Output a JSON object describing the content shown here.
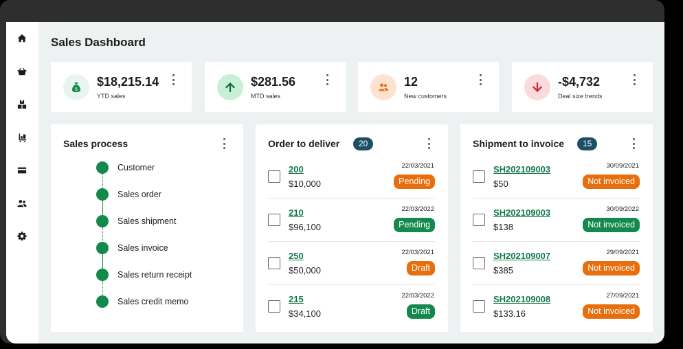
{
  "page_title": "Sales Dashboard",
  "colors": {
    "green_badge": "#138a4b",
    "orange_badge": "#e86d0c",
    "dark_badge": "#1d4e63",
    "link": "#14794a"
  },
  "sidebar": {
    "items": [
      {
        "icon": "home-icon"
      },
      {
        "icon": "basket-icon"
      },
      {
        "icon": "boxes-icon"
      },
      {
        "icon": "forklift-icon"
      },
      {
        "icon": "card-icon"
      },
      {
        "icon": "people-icon"
      },
      {
        "icon": "gear-icon"
      }
    ]
  },
  "kpis": [
    {
      "value": "$18,215.14",
      "label": "YTD sales",
      "icon": "money-bag-icon",
      "bg": "#e8f4ee",
      "fg": "#138a4b"
    },
    {
      "value": "$281.56",
      "label": "MTD sales",
      "icon": "arrow-up-icon",
      "bg": "#c8f0d6",
      "fg": "#0f6b3a"
    },
    {
      "value": "12",
      "label": "New customers",
      "icon": "people-icon",
      "bg": "#fde2d2",
      "fg": "#e86d0c"
    },
    {
      "value": "-$4,732",
      "label": "Deal size trends",
      "icon": "arrow-down-icon",
      "bg": "#fadadd",
      "fg": "#c62828"
    }
  ],
  "sales_process": {
    "title": "Sales process",
    "steps": [
      "Customer",
      "Sales order",
      "Sales shipment",
      "Sales invoice",
      "Sales return receipt",
      "Sales credit memo"
    ]
  },
  "order_to_deliver": {
    "title": "Order to deliver",
    "count": "20",
    "rows": [
      {
        "id": "200",
        "amount": "$10,000",
        "date": "22/03/2021",
        "status": "Pending",
        "status_color": "orange"
      },
      {
        "id": "210",
        "amount": "$96,100",
        "date": "22/03/2022",
        "status": "Pending",
        "status_color": "green"
      },
      {
        "id": "250",
        "amount": "$50,000",
        "date": "22/03/2021",
        "status": "Draft",
        "status_color": "orange"
      },
      {
        "id": "215",
        "amount": "$34,100",
        "date": "22/03/2022",
        "status": "Draft",
        "status_color": "green"
      }
    ]
  },
  "shipment_to_invoice": {
    "title": "Shipment to invoice",
    "count": "15",
    "rows": [
      {
        "id": "SH202109003",
        "amount": "$50",
        "date": "30/09/2021",
        "status": "Not invoiced",
        "status_color": "orange"
      },
      {
        "id": "SH202109003",
        "amount": "$138",
        "date": "30/09/2022",
        "status": "Not invoiced",
        "status_color": "green"
      },
      {
        "id": "SH202109007",
        "amount": "$385",
        "date": "29/09/2021",
        "status": "Not invoiced",
        "status_color": "orange"
      },
      {
        "id": "SH202109008",
        "amount": "$133.16",
        "date": "27/09/2021",
        "status": "Not invoiced",
        "status_color": "orange"
      }
    ]
  }
}
